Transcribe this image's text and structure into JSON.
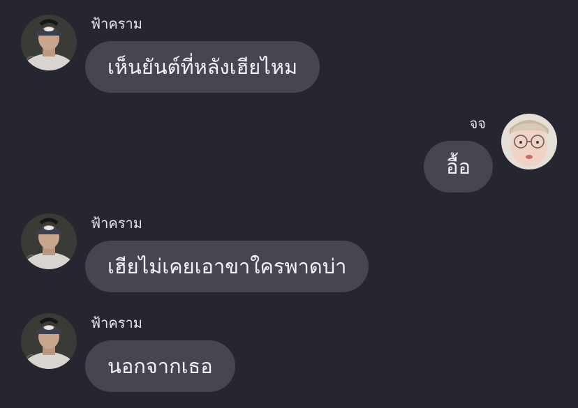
{
  "conversation": {
    "messages": [
      {
        "sender": "ฟ้าคราม",
        "text": "เห็นยันต์ที่หลังเฮียไหม",
        "side": "left"
      },
      {
        "sender": "จจ",
        "text": "อื้อ",
        "side": "right"
      },
      {
        "sender": "ฟ้าคราม",
        "text": "เฮียไม่เคยเอาขาใครพาดบ่า",
        "side": "left"
      },
      {
        "sender": "ฟ้าคราม",
        "text": "นอกจากเธอ",
        "side": "left"
      }
    ]
  },
  "colors": {
    "background": "#25262f",
    "bubble": "#454650",
    "text": "#f3f3f5"
  }
}
